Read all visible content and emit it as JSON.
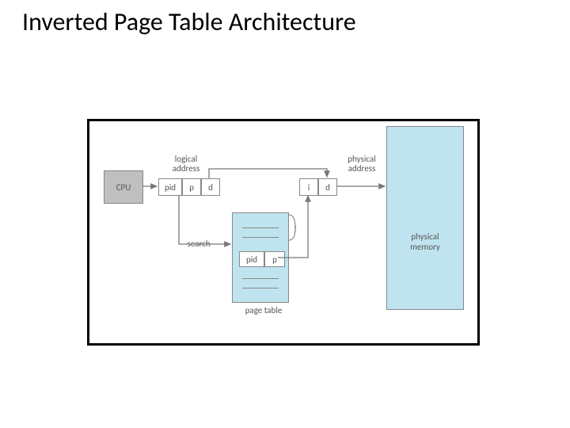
{
  "title": "Inverted Page Table Architecture",
  "cpu": "CPU",
  "logical_address_label": "logical\naddress",
  "physical_address_label": "physical\naddress",
  "la": {
    "pid": "pid",
    "p": "p",
    "d": "d"
  },
  "pa": {
    "i": "i",
    "d": "d"
  },
  "search_label": "search",
  "page_table_label": "page table",
  "pt_row": {
    "pid": "pid",
    "p": "p"
  },
  "i_annot": "i",
  "physmem_label": "physical\nmemory"
}
